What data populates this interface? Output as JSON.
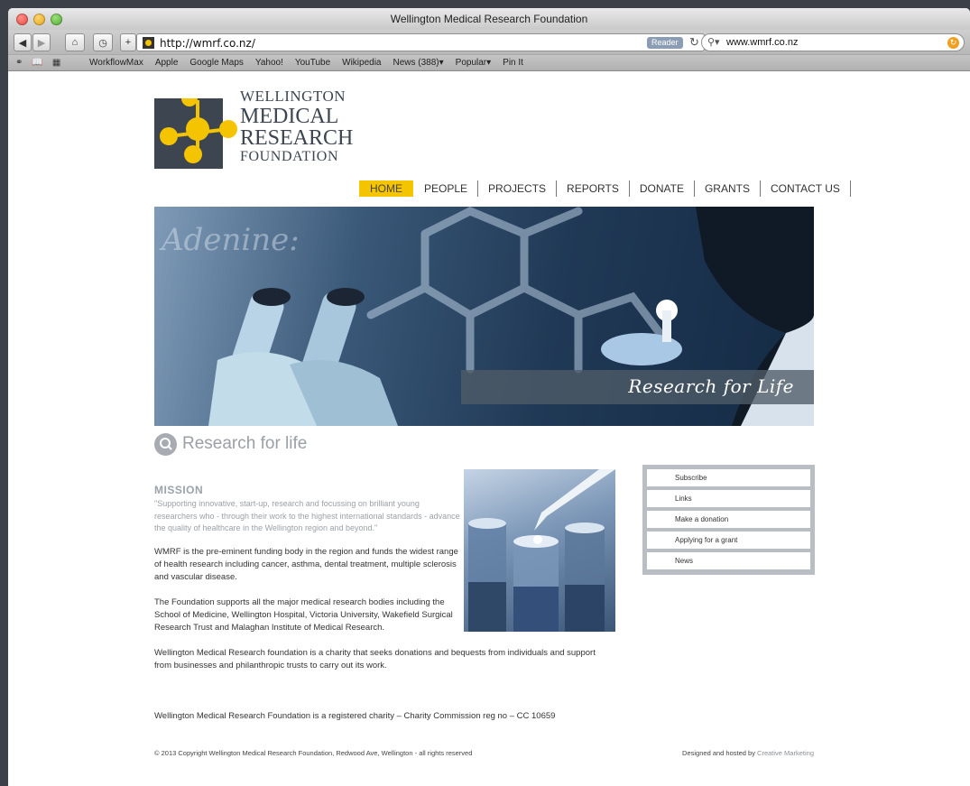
{
  "window": {
    "title": "Wellington Medical Research Foundation"
  },
  "toolbar": {
    "url": "http://wmrf.co.nz/",
    "reader_label": "Reader",
    "search_value": "www.wmrf.co.nz"
  },
  "bookmarks": [
    "WorkflowMax",
    "Apple",
    "Google Maps",
    "Yahoo!",
    "YouTube",
    "Wikipedia",
    "News (388)▾",
    "Popular▾",
    "Pin It"
  ],
  "logo": {
    "line1": "WELLINGTON",
    "line2": "MEDICAL",
    "line3": "RESEARCH",
    "line4": "FOUNDATION"
  },
  "nav": {
    "items": [
      "HOME",
      "PEOPLE",
      "PROJECTS",
      "REPORTS",
      "DONATE",
      "GRANTS",
      "CONTACT US"
    ],
    "active": "HOME"
  },
  "hero": {
    "caption": "Research for Life"
  },
  "tagline": "Research for life",
  "content": {
    "mission_heading": "MISSION",
    "mission_quote": "\"Supporting innovative, start-up, research and focussing on brilliant young researchers who - through their work to the highest international standards - advance the quality of healthcare in the Wellington region and beyond.\"",
    "paragraph1": "WMRF is the pre-eminent funding body in the region and funds the widest range of health research including cancer, asthma, dental treatment, multiple sclerosis and vascular disease.",
    "paragraph2": "The Foundation supports all the major medical research bodies including the School of Medicine, Wellington Hospital, Victoria University, Wakefield Surgical Research Trust and Malaghan Institute of Medical Research.",
    "paragraph3": "Wellington Medical Research foundation is a charity that seeks donations and bequests from individuals and support from businesses and philanthropic trusts to carry out its work.",
    "charity_note": "Wellington Medical Research Foundation is a registered charity – Charity Commission reg no – CC 10659"
  },
  "sidebar": {
    "links": [
      "Subscribe",
      "Links",
      "Make a donation",
      "Applying for a grant",
      "News"
    ]
  },
  "footer": {
    "copyright": "© 2013 Copyright Wellington Medical Research Foundation, Redwood Ave, Wellington - all rights reserved",
    "designed_by": "Designed and hosted by",
    "credit": "Creative Marketing"
  },
  "colors": {
    "accent": "#f5c400",
    "logo_dark": "#3d4650"
  }
}
